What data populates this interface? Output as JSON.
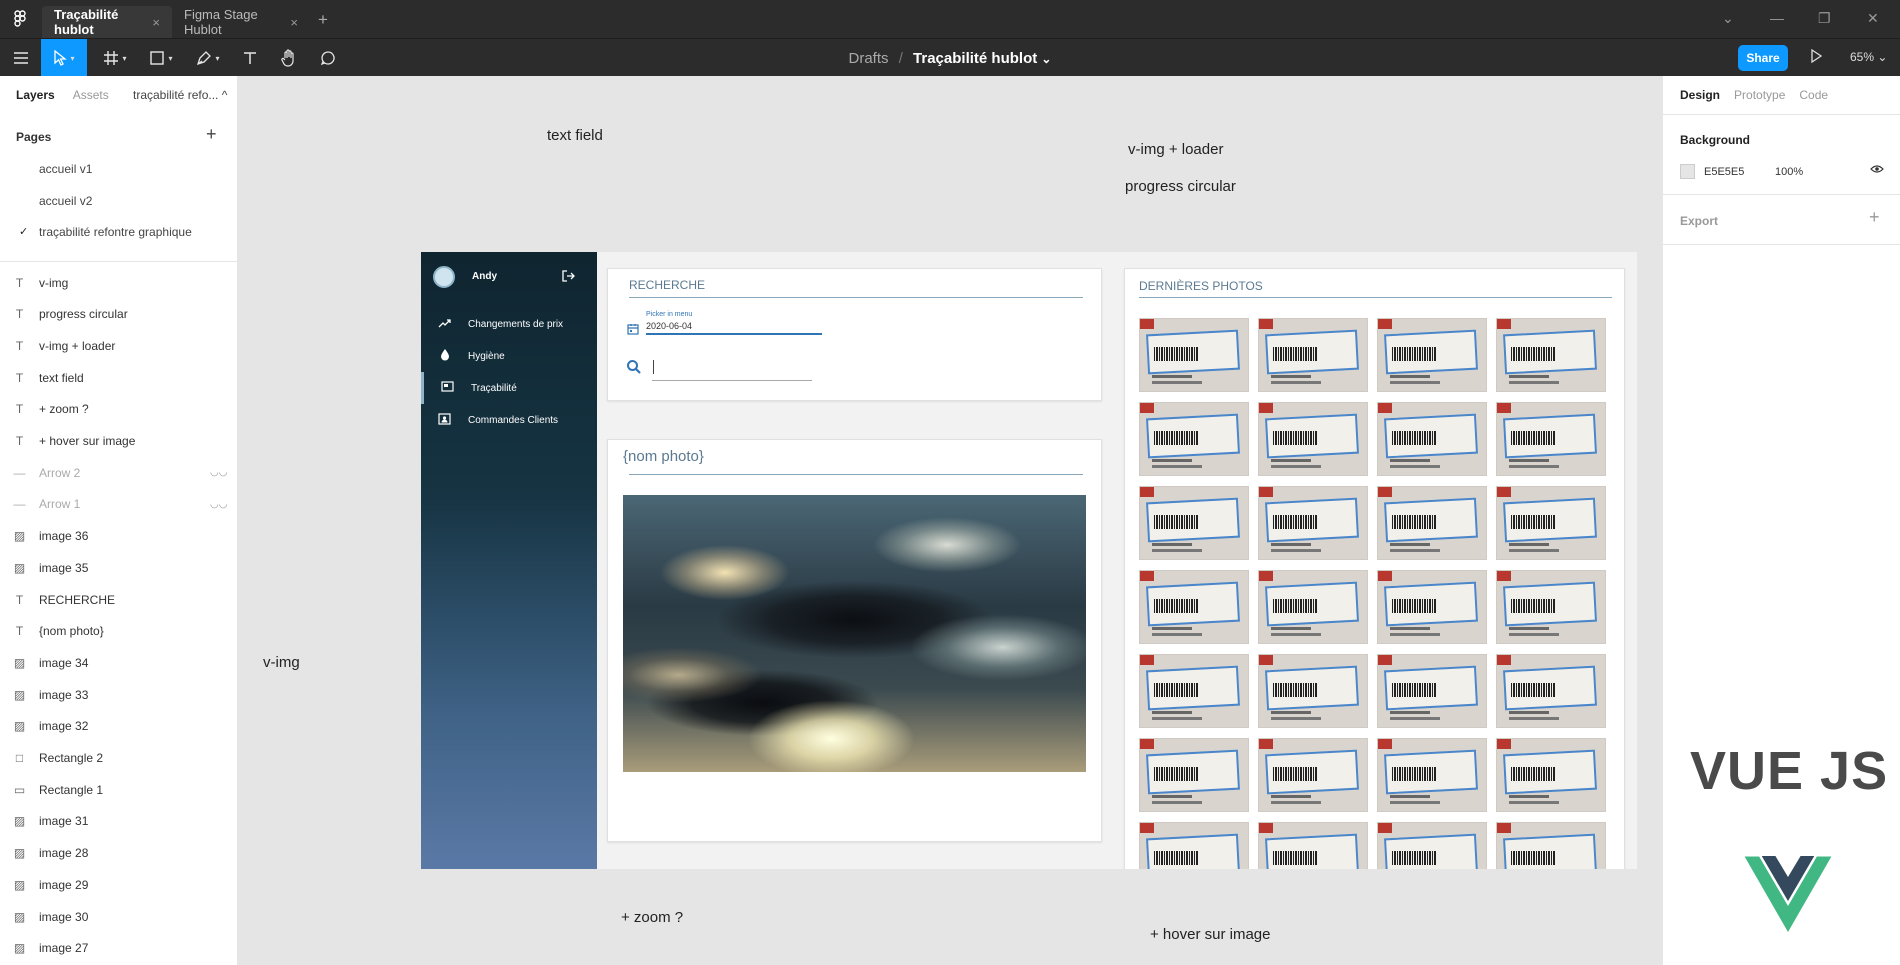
{
  "titlebar": {
    "tabs": [
      {
        "label": "Traçabilité hublot",
        "close": "×"
      },
      {
        "label": "Figma Stage Hublot",
        "close": "×"
      }
    ],
    "add_tab": "+",
    "window_controls": {
      "dropdown": "⌄",
      "minimize": "—",
      "restore": "❐",
      "close": "✕"
    }
  },
  "toolbar": {
    "breadcrumb_root": "Drafts",
    "breadcrumb_sep": "/",
    "file_name": "Traçabilité hublot",
    "file_caret": "⌄",
    "share_label": "Share",
    "zoom_label": "65% ⌄"
  },
  "left_panel": {
    "tabs": [
      "Layers",
      "Assets"
    ],
    "page_select": "traçabilité refo... ^",
    "pages_header": "Pages",
    "pages_add": "+",
    "pages": [
      "accueil v1",
      "accueil v2",
      "traçabilité refontre graphique"
    ],
    "current_page_check": "✓",
    "layers": [
      {
        "icon": "T",
        "name": "v-img"
      },
      {
        "icon": "T",
        "name": "progress circular"
      },
      {
        "icon": "T",
        "name": "v-img + loader"
      },
      {
        "icon": "T",
        "name": "text field"
      },
      {
        "icon": "T",
        "name": "+ zoom ?"
      },
      {
        "icon": "T",
        "name": "+ hover sur image"
      },
      {
        "icon": "—",
        "name": "Arrow 2",
        "hidden": true
      },
      {
        "icon": "—",
        "name": "Arrow 1",
        "hidden": true
      },
      {
        "icon": "▨",
        "name": "image 36"
      },
      {
        "icon": "▨",
        "name": "image 35"
      },
      {
        "icon": "T",
        "name": "RECHERCHE"
      },
      {
        "icon": "T",
        "name": "{nom photo}"
      },
      {
        "icon": "▨",
        "name": "image 34"
      },
      {
        "icon": "▨",
        "name": "image 33"
      },
      {
        "icon": "▨",
        "name": "image 32"
      },
      {
        "icon": "□",
        "name": "Rectangle 2"
      },
      {
        "icon": "▭",
        "name": "Rectangle 1"
      },
      {
        "icon": "▨",
        "name": "image 31"
      },
      {
        "icon": "▨",
        "name": "image 28"
      },
      {
        "icon": "▨",
        "name": "image 29"
      },
      {
        "icon": "▨",
        "name": "image 30"
      },
      {
        "icon": "▨",
        "name": "image 27"
      }
    ]
  },
  "canvas": {
    "labels": {
      "text_field": "text field",
      "vimg_loader": "v-img + loader",
      "progress_circular": "progress circular",
      "vimg": "v-img",
      "zoom": "+ zoom ?",
      "hover": "+ hover sur image"
    },
    "app": {
      "user_name": "Andy",
      "nav": [
        {
          "icon": "trending-up-icon",
          "label": "Changements de prix"
        },
        {
          "icon": "droplet-icon",
          "label": "Hygiène"
        },
        {
          "icon": "id-card-icon",
          "label": "Traçabilité"
        },
        {
          "icon": "contact-icon",
          "label": "Commandes Clients"
        }
      ],
      "search_title": "RECHERCHE",
      "date_label": "Picker in menu",
      "date_value": "2020-06-04",
      "photo_title": "{nom photo}",
      "recent_title": "DERNIÈRES PHOTOS",
      "photo_rows": 7,
      "photo_cols": 4
    }
  },
  "right_panel": {
    "tabs": [
      "Design",
      "Prototype",
      "Code"
    ],
    "background_label": "Background",
    "bg_hex": "E5E5E5",
    "bg_opacity": "100%",
    "export_label": "Export",
    "export_add": "+",
    "vue_text": "VUE JS"
  },
  "colors": {
    "accent": "#0d99ff",
    "canvas_bg": "#e5e5e5",
    "sidebar_top": "#0f2530",
    "sidebar_bottom": "#5b79a6",
    "vue_green": "#41b883",
    "vue_dark": "#35495e"
  }
}
